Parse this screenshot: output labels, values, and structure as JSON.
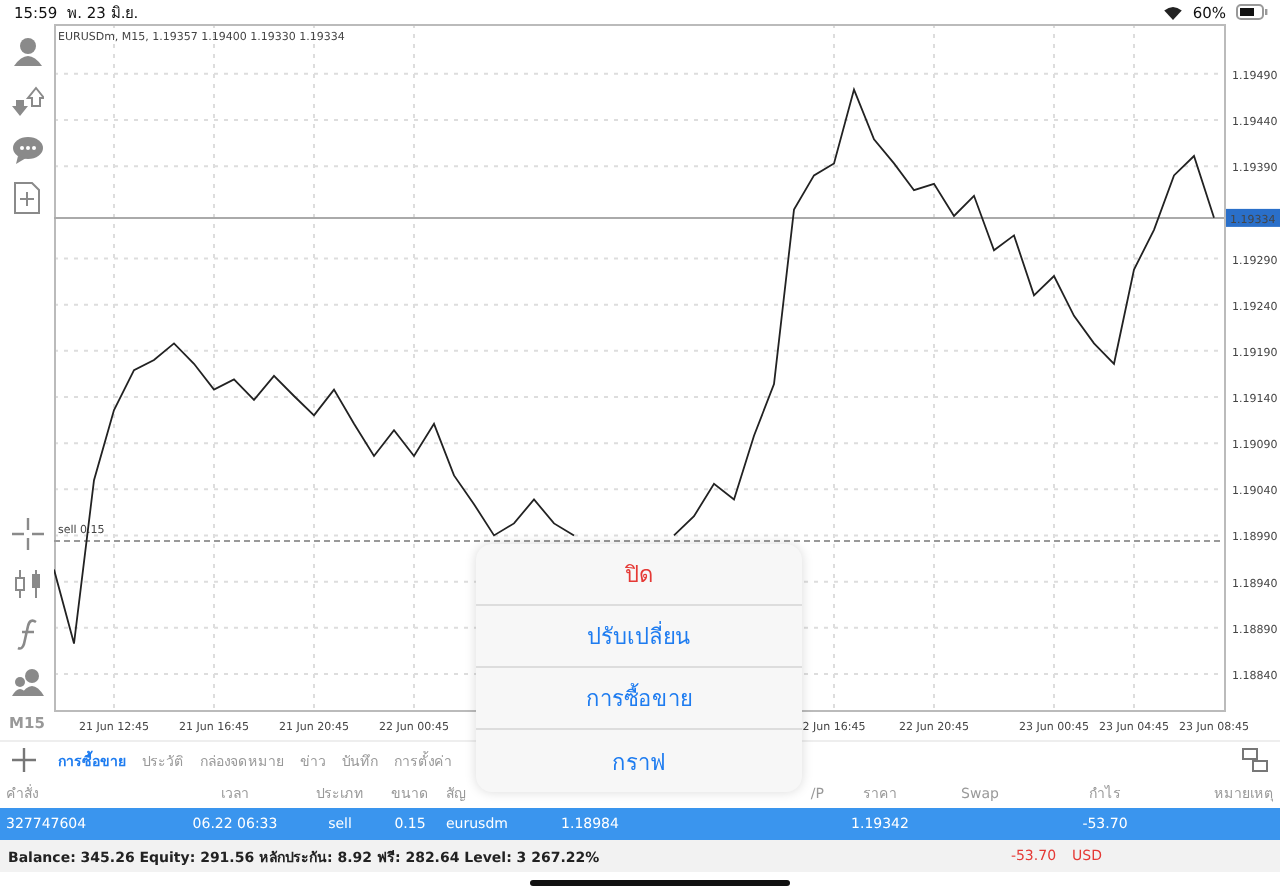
{
  "status_bar": {
    "time": "15:59",
    "date": "พ. 23 มิ.ย.",
    "battery": "60%"
  },
  "toolbar": {
    "timeframe": "M15"
  },
  "chart": {
    "title": "EURUSDm, M15, 1.19357 1.19400 1.19330 1.19334",
    "chart_data": {
      "type": "line",
      "grid": true,
      "ylim": [
        1.18801,
        1.19544
      ],
      "categories": [
        null,
        null,
        null,
        "21 Jun 12:45",
        null,
        null,
        null,
        null,
        "21 Jun 16:45",
        null,
        null,
        null,
        null,
        "21 Jun 20:45",
        null,
        null,
        null,
        null,
        "22 Jun 00:45",
        null,
        null,
        null,
        null,
        null,
        null,
        null,
        null,
        null,
        null,
        null,
        null,
        null,
        null,
        null,
        null,
        null,
        null,
        null,
        null,
        "2 Jun 16:45",
        null,
        null,
        null,
        null,
        "22 Jun 20:45",
        null,
        null,
        null,
        null,
        null,
        "23 Jun 00:45",
        null,
        null,
        null,
        "23 Jun 04:45",
        null,
        null,
        null,
        "23 Jun 08:45"
      ],
      "ref_lines": [
        {
          "axis": "y",
          "value": 1.18984,
          "label": "sell 0.15"
        },
        {
          "axis": "y",
          "value": 1.19334,
          "label": "1.19334"
        }
      ],
      "yticks": [
        {
          "value": 1.1949,
          "label": "1.19490"
        },
        {
          "value": 1.1944,
          "label": "1.19440"
        },
        {
          "value": 1.1939,
          "label": "1.19390"
        },
        {
          "value": 1.1929,
          "label": "1.19290"
        },
        {
          "value": 1.1924,
          "label": "1.19240"
        },
        {
          "value": 1.1919,
          "label": "1.19190"
        },
        {
          "value": 1.1914,
          "label": "1.19140"
        },
        {
          "value": 1.1909,
          "label": "1.19090"
        },
        {
          "value": 1.1904,
          "label": "1.19040"
        },
        {
          "value": 1.1899,
          "label": "1.18990"
        },
        {
          "value": 1.1894,
          "label": "1.18940"
        },
        {
          "value": 1.1889,
          "label": "1.18890"
        },
        {
          "value": 1.1884,
          "label": "1.18840"
        }
      ],
      "series": [
        {
          "color": "#222222",
          "values": [
            1.18953,
            1.18873,
            1.1905,
            1.19126,
            1.19169,
            1.1918,
            1.19198,
            1.19176,
            1.19148,
            1.19159,
            1.19137,
            1.19163,
            1.19141,
            1.1912,
            1.19148,
            1.19111,
            1.19076,
            1.19104,
            1.19076,
            1.19111,
            1.19055,
            1.19024,
            1.1899,
            1.19003,
            1.19029,
            1.19003,
            1.1899,
            null,
            null,
            null,
            null,
            1.1899,
            1.19011,
            1.19046,
            1.19029,
            1.19098,
            1.19154,
            1.19343,
            1.1938,
            1.19393,
            1.19473,
            1.19419,
            1.19393,
            1.19364,
            1.19371,
            1.19336,
            1.19358,
            1.19299,
            1.19315,
            1.1925,
            1.19271,
            1.19228,
            1.19198,
            1.19176,
            1.19278,
            1.19321,
            1.1938,
            1.19401,
            1.19334
          ]
        }
      ]
    }
  },
  "tabs": [
    {
      "label": "การซื้อขาย",
      "selected": true
    },
    {
      "label": "ประวัติ",
      "selected": false
    },
    {
      "label": "กล่องจดหมาย",
      "selected": false
    },
    {
      "label": "ข่าว",
      "selected": false
    },
    {
      "label": "บันทึก",
      "selected": false
    },
    {
      "label": "การตั้งค่า",
      "selected": false
    }
  ],
  "table": {
    "columns": [
      "คำสั่ง",
      "เวลา",
      "ประเภท",
      "ขนาด",
      "สัญ",
      "/P",
      "ราคา",
      "Swap",
      "กำไร",
      "หมายเหตุ"
    ],
    "rows": [
      {
        "selected": true,
        "cells": [
          "327747604",
          "06.22 06:33",
          "sell",
          "0.15",
          "eurusdm",
          "1.18984",
          "1.19342",
          "",
          "-53.70"
        ]
      }
    ]
  },
  "summary": {
    "text": "Balance: 345.26 Equity: 291.56 หลักประกัน: 8.92 ฟรี: 282.64 Level: 3 267.22%",
    "profit": "-53.70",
    "currency": "USD"
  },
  "menu": {
    "items": [
      {
        "label": "ปิด",
        "kind": "destructive"
      },
      {
        "label": "ปรับเปลี่ยน",
        "kind": "default"
      },
      {
        "label": "การซื้อขาย",
        "kind": "default"
      },
      {
        "label": "กราฟ",
        "kind": "default"
      }
    ]
  }
}
